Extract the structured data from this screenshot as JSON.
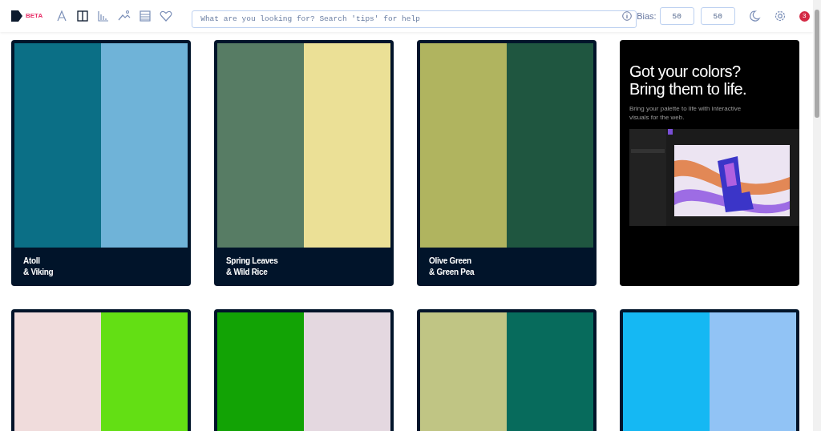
{
  "header": {
    "beta": "BETA",
    "search": {
      "placeholder": "What are you looking for? Search 'tips' for help"
    },
    "bias_label": "Bias:",
    "bias_values": [
      "50",
      "50"
    ],
    "notifications": "3"
  },
  "cards": [
    {
      "kind": "palette",
      "name": "Atoll",
      "pair": "& Viking",
      "swatches": [
        {
          "color": "#0b6f86"
        },
        {
          "color": "#6fb3d8"
        }
      ]
    },
    {
      "kind": "palette",
      "name": "Spring Leaves",
      "pair": "& Wild Rice",
      "swatches": [
        {
          "color": "#577c64"
        },
        {
          "color": "#ebe096"
        }
      ]
    },
    {
      "kind": "palette",
      "name": "Olive Green",
      "pair": "& Green Pea",
      "swatches": [
        {
          "color": "#b0b45f"
        },
        {
          "color": "#1f5640"
        }
      ]
    },
    {
      "kind": "ad",
      "title": "Got your colors? Bring them to life.",
      "text": "Bring your palette to life with interactive visuals for the web."
    },
    {
      "kind": "palette",
      "swatches": [
        {
          "color": "#f0dcdc"
        },
        {
          "color": "#63df14"
        }
      ]
    },
    {
      "kind": "palette",
      "swatches": [
        {
          "color": "#12a305"
        },
        {
          "color": "#e4d8e0"
        }
      ]
    },
    {
      "kind": "palette",
      "swatches": [
        {
          "color": "#c0c584"
        },
        {
          "color": "#076b5c"
        }
      ]
    },
    {
      "kind": "palette",
      "swatches": [
        {
          "color": "#15b8f3"
        },
        {
          "color": "#91c3f5"
        }
      ]
    }
  ]
}
